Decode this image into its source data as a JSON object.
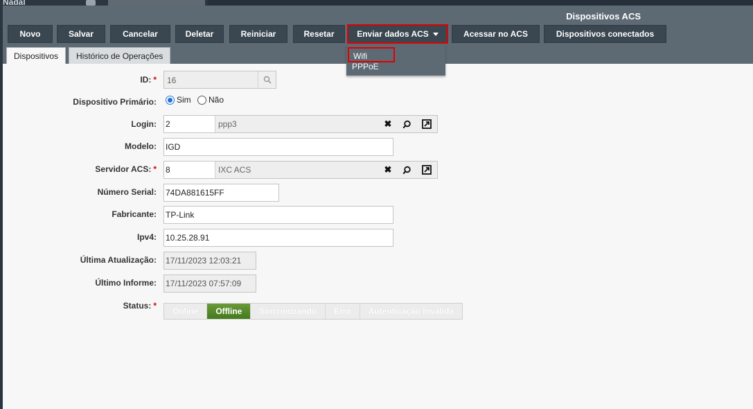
{
  "background": {
    "user_label": "Nadal"
  },
  "window": {
    "title": "Dispositivos ACS"
  },
  "toolbar": {
    "novo": "Novo",
    "salvar": "Salvar",
    "cancelar": "Cancelar",
    "deletar": "Deletar",
    "reiniciar": "Reiniciar",
    "resetar": "Resetar",
    "enviar_dados_acs": "Enviar dados ACS",
    "acessar_acs": "Acessar no ACS",
    "dispositivos_conectados": "Dispositivos conectados"
  },
  "dropdown": {
    "items": [
      "Wifi",
      "PPPoE"
    ]
  },
  "tabs": [
    "Dispositivos",
    "Histórico de Operações"
  ],
  "form": {
    "id": {
      "label": "ID:",
      "value": "16"
    },
    "dispositivo_primario": {
      "label": "Dispositivo Primário:",
      "options": [
        "Sim",
        "Não"
      ],
      "selected": "Sim"
    },
    "login": {
      "label": "Login:",
      "code": "2",
      "description": "ppp3"
    },
    "modelo": {
      "label": "Modelo:",
      "value": "IGD"
    },
    "servidor_acs": {
      "label": "Servidor ACS:",
      "code": "8",
      "description": "IXC ACS"
    },
    "numero_serial": {
      "label": "Número Serial:",
      "value": "74DA881615FF"
    },
    "fabricante": {
      "label": "Fabricante:",
      "value": "TP-Link"
    },
    "ipv4": {
      "label": "Ipv4:",
      "value": "10.25.28.91"
    },
    "ultima_atualizacao": {
      "label": "Última Atualização:",
      "value": "17/11/2023 12:03:21"
    },
    "ultimo_informe": {
      "label": "Último Informe:",
      "value": "17/11/2023 07:57:09"
    },
    "status": {
      "label": "Status:",
      "options": [
        "Online",
        "Offline",
        "Sincronizando",
        "Erro",
        "Autenticação Inválida"
      ],
      "selected": "Offline"
    }
  },
  "required_mark": "*",
  "icons": {
    "clear": "✖",
    "search": "⌕",
    "open": "↗"
  },
  "colors": {
    "toolbar": "#3a4650",
    "header": "#5d6a74",
    "active_status": "#4a8222",
    "highlight": "#e00000",
    "required": "#d00000"
  }
}
